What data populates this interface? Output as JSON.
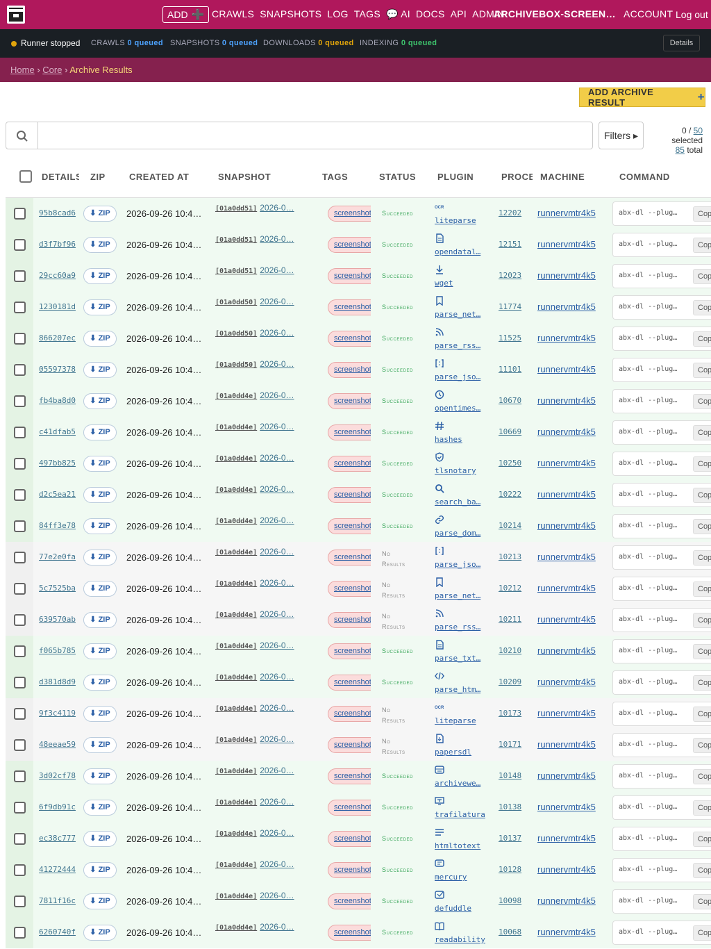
{
  "nav": {
    "add_label": "ADD",
    "links": [
      "CRAWLS",
      "SNAPSHOTS",
      "LOG",
      "TAGS",
      "💬 AI",
      "DOCS",
      "API",
      "ADMIN"
    ],
    "user": "ARCHIVEBOX-SCREENSHOTS",
    "account": "ACCOUNT",
    "logout": "Log out"
  },
  "status": {
    "runner": "Runner stopped",
    "crawls_label": "CRAWLS",
    "crawls_val": "0 queued",
    "snapshots_label": "SNAPSHOTS",
    "snapshots_val": "0 queued",
    "downloads_label": "DOWNLOADS",
    "downloads_val": "0 queued",
    "indexing_label": "INDEXING",
    "indexing_val": "0 queued",
    "details": "Details",
    "colors": {
      "crawls": "#4da3ff",
      "snapshots": "#4da3ff",
      "downloads": "#e0a40c",
      "indexing": "#3ec46d"
    }
  },
  "breadcrumb": {
    "home": "Home",
    "core": "Core",
    "sep": "›",
    "current": "Archive Results"
  },
  "actions": {
    "add_result": "ADD ARCHIVE RESULT"
  },
  "search": {
    "placeholder": "",
    "filters": "Filters ▸"
  },
  "selection": {
    "selected": "0",
    "page": "50",
    "selected_suffix": "selected",
    "total": "85",
    "total_suffix": "total"
  },
  "columns": [
    "DETAILS",
    "ZIP",
    "CREATED AT",
    "SNAPSHOT",
    "TAGS",
    "STATUS",
    "PLUGIN",
    "PROCESS",
    "MACHINE",
    "COMMAND"
  ],
  "common": {
    "zip": "⬇ ZIP",
    "created": "2026-09-26 10:4…",
    "tag": "screenshot",
    "machine": "runnervmtr4k5",
    "command": "abx-dl --plug…",
    "copy": "Copy",
    "succeeded": "Succeeded",
    "no_results_1": "No",
    "no_results_2": "Results"
  },
  "rows": [
    {
      "id": "95b8cad6",
      "snap_id": "[01a0dd51]",
      "snap_date": "2026-0…",
      "status": "succeeded",
      "icon": "ocr-icon",
      "plugin": "liteparse",
      "process": "12202"
    },
    {
      "id": "d3f7bf96",
      "snap_id": "[01a0dd51]",
      "snap_date": "2026-0…",
      "status": "succeeded",
      "icon": "document-icon",
      "plugin": "opendatal…",
      "process": "12151"
    },
    {
      "id": "29cc60a9",
      "snap_id": "[01a0dd51]",
      "snap_date": "2026-0…",
      "status": "succeeded",
      "icon": "download-icon",
      "plugin": "wget",
      "process": "12023"
    },
    {
      "id": "1230181d",
      "snap_id": "[01a0dd50]",
      "snap_date": "2026-0…",
      "status": "succeeded",
      "icon": "bookmark-icon",
      "plugin": "parse_net…",
      "process": "11774"
    },
    {
      "id": "866207ec",
      "snap_id": "[01a0dd50]",
      "snap_date": "2026-0…",
      "status": "succeeded",
      "icon": "rss-icon",
      "plugin": "parse_rss…",
      "process": "11525"
    },
    {
      "id": "05597378",
      "snap_id": "[01a0dd50]",
      "snap_date": "2026-0…",
      "status": "succeeded",
      "icon": "json-icon",
      "plugin": "parse_jso…",
      "process": "11101"
    },
    {
      "id": "fb4ba8d0",
      "snap_id": "[01a0dd4e]",
      "snap_date": "2026-0…",
      "status": "succeeded",
      "icon": "clock-icon",
      "plugin": "opentimes…",
      "process": "10670"
    },
    {
      "id": "c41dfab5",
      "snap_id": "[01a0dd4e]",
      "snap_date": "2026-0…",
      "status": "succeeded",
      "icon": "hash-icon",
      "plugin": "hashes",
      "process": "10669"
    },
    {
      "id": "497bb825",
      "snap_id": "[01a0dd4e]",
      "snap_date": "2026-0…",
      "status": "succeeded",
      "icon": "shield-icon",
      "plugin": "tlsnotary",
      "process": "10250"
    },
    {
      "id": "d2c5ea21",
      "snap_id": "[01a0dd4e]",
      "snap_date": "2026-0…",
      "status": "succeeded",
      "icon": "search-icon",
      "plugin": "search_ba…",
      "process": "10222"
    },
    {
      "id": "84ff3e78",
      "snap_id": "[01a0dd4e]",
      "snap_date": "2026-0…",
      "status": "succeeded",
      "icon": "link-icon",
      "plugin": "parse_dom…",
      "process": "10214"
    },
    {
      "id": "77e2e0fa",
      "snap_id": "[01a0dd4e]",
      "snap_date": "2026-0…",
      "status": "no_results",
      "icon": "json-icon",
      "plugin": "parse_jso…",
      "process": "10213"
    },
    {
      "id": "5c7525ba",
      "snap_id": "[01a0dd4e]",
      "snap_date": "2026-0…",
      "status": "no_results",
      "icon": "bookmark-icon",
      "plugin": "parse_net…",
      "process": "10212"
    },
    {
      "id": "639570ab",
      "snap_id": "[01a0dd4e]",
      "snap_date": "2026-0…",
      "status": "no_results",
      "icon": "rss-icon",
      "plugin": "parse_rss…",
      "process": "10211"
    },
    {
      "id": "f065b785",
      "snap_id": "[01a0dd4e]",
      "snap_date": "2026-0…",
      "status": "succeeded",
      "icon": "document-icon",
      "plugin": "parse_txt…",
      "process": "10210"
    },
    {
      "id": "d381d8d9",
      "snap_id": "[01a0dd4e]",
      "snap_date": "2026-0…",
      "status": "succeeded",
      "icon": "code-icon",
      "plugin": "parse_htm…",
      "process": "10209"
    },
    {
      "id": "9f3c4119",
      "snap_id": "[01a0dd4e]",
      "snap_date": "2026-0…",
      "status": "no_results",
      "icon": "ocr-icon",
      "plugin": "liteparse",
      "process": "10173"
    },
    {
      "id": "48eeae59",
      "snap_id": "[01a0dd4e]",
      "snap_date": "2026-0…",
      "status": "no_results",
      "icon": "file-icon",
      "plugin": "papersdl",
      "process": "10171"
    },
    {
      "id": "3d02cf78",
      "snap_id": "[01a0dd4e]",
      "snap_date": "2026-0…",
      "status": "succeeded",
      "icon": "archive-icon",
      "plugin": "archivewe…",
      "process": "10148"
    },
    {
      "id": "6f9db91c",
      "snap_id": "[01a0dd4e]",
      "snap_date": "2026-0…",
      "status": "succeeded",
      "icon": "text-icon",
      "plugin": "trafilatura",
      "process": "10138"
    },
    {
      "id": "ec38c777",
      "snap_id": "[01a0dd4e]",
      "snap_date": "2026-0…",
      "status": "succeeded",
      "icon": "lines-icon",
      "plugin": "htmltotext",
      "process": "10137"
    },
    {
      "id": "41272444",
      "snap_id": "[01a0dd4e]",
      "snap_date": "2026-0…",
      "status": "succeeded",
      "icon": "message-icon",
      "plugin": "mercury",
      "process": "10128"
    },
    {
      "id": "7811f16c",
      "snap_id": "[01a0dd4e]",
      "snap_date": "2026-0…",
      "status": "succeeded",
      "icon": "clean-icon",
      "plugin": "defuddle",
      "process": "10098"
    },
    {
      "id": "6260740f",
      "snap_id": "[01a0dd4e]",
      "snap_date": "2026-0…",
      "status": "succeeded",
      "icon": "book-icon",
      "plugin": "readability",
      "process": "10068"
    }
  ]
}
